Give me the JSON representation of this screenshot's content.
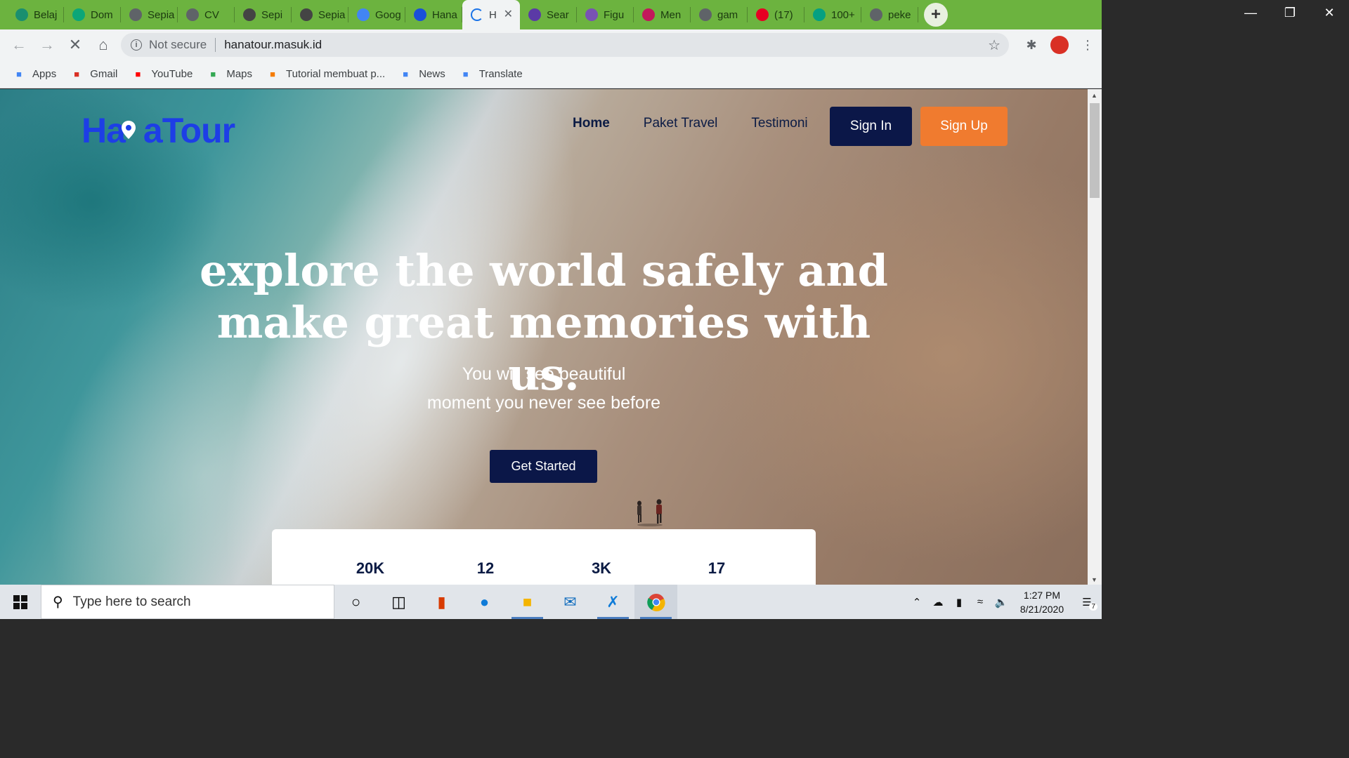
{
  "browser": {
    "tabs": [
      {
        "title": "Belaj",
        "icon": "graduation-icon",
        "color": "#1a8f6f"
      },
      {
        "title": "Dom",
        "icon": "diamond-icon",
        "color": "#0ca678"
      },
      {
        "title": "Sepia",
        "icon": "globe-icon",
        "color": "#5f6368"
      },
      {
        "title": "CV",
        "icon": "globe-icon",
        "color": "#5f6368"
      },
      {
        "title": "Sepi",
        "icon": "avatar-icon",
        "color": "#444444"
      },
      {
        "title": "Sepia",
        "icon": "avatar-icon",
        "color": "#444444"
      },
      {
        "title": "Goog",
        "icon": "translate-icon",
        "color": "#4285f4"
      },
      {
        "title": "Hana",
        "icon": "hana-icon",
        "color": "#1a4fd8"
      },
      {
        "title": "H",
        "icon": "loading-icon",
        "color": "#1a73e8",
        "active": true
      },
      {
        "title": "Sear",
        "icon": "search-person-icon",
        "color": "#5b3aa6"
      },
      {
        "title": "Figu",
        "icon": "bootstrap-icon",
        "color": "#7952b3"
      },
      {
        "title": "Men",
        "icon": "shrine-icon",
        "color": "#c2185b"
      },
      {
        "title": "gam",
        "icon": "globe-icon",
        "color": "#5f6368"
      },
      {
        "title": "(17)",
        "icon": "pinterest-icon",
        "color": "#e60023"
      },
      {
        "title": "100+",
        "icon": "pexels-icon",
        "color": "#05a081"
      },
      {
        "title": "peke",
        "icon": "globe-icon",
        "color": "#5f6368"
      }
    ],
    "address": {
      "security_label": "Not secure",
      "url": "hanatour.masuk.id"
    },
    "bookmarks": [
      {
        "label": "Apps",
        "icon": "apps-grid-icon",
        "color": "#4285f4"
      },
      {
        "label": "Gmail",
        "icon": "gmail-icon",
        "color": "#d93025"
      },
      {
        "label": "YouTube",
        "icon": "youtube-icon",
        "color": "#ff0000"
      },
      {
        "label": "Maps",
        "icon": "maps-pin-icon",
        "color": "#34a853"
      },
      {
        "label": "Tutorial membuat p...",
        "icon": "blogger-icon",
        "color": "#f57c00"
      },
      {
        "label": "News",
        "icon": "news-icon",
        "color": "#4285f4"
      },
      {
        "label": "Translate",
        "icon": "translate-icon",
        "color": "#4285f4"
      }
    ]
  },
  "site": {
    "logo": {
      "part1": "Ha",
      "part2": "aTour",
      "color": "#1d3ee6"
    },
    "nav": {
      "home": "Home",
      "packages": "Paket Travel",
      "testimonials": "Testimoni"
    },
    "sign_in": "Sign In",
    "sign_up": "Sign Up",
    "hero": {
      "title_line1": "explore the world safely and",
      "title_line2": "make great memories with us.",
      "sub_line1": "You will see beautiful",
      "sub_line2": "moment you never see before",
      "cta": "Get Started"
    },
    "stats": [
      "20K",
      "12",
      "3K",
      "17"
    ],
    "colors": {
      "navy": "#0b1748",
      "orange": "#f07b2f"
    }
  },
  "taskbar": {
    "search_placeholder": "Type here to search",
    "time": "1:27 PM",
    "date": "8/21/2020",
    "notification_count": "7"
  }
}
